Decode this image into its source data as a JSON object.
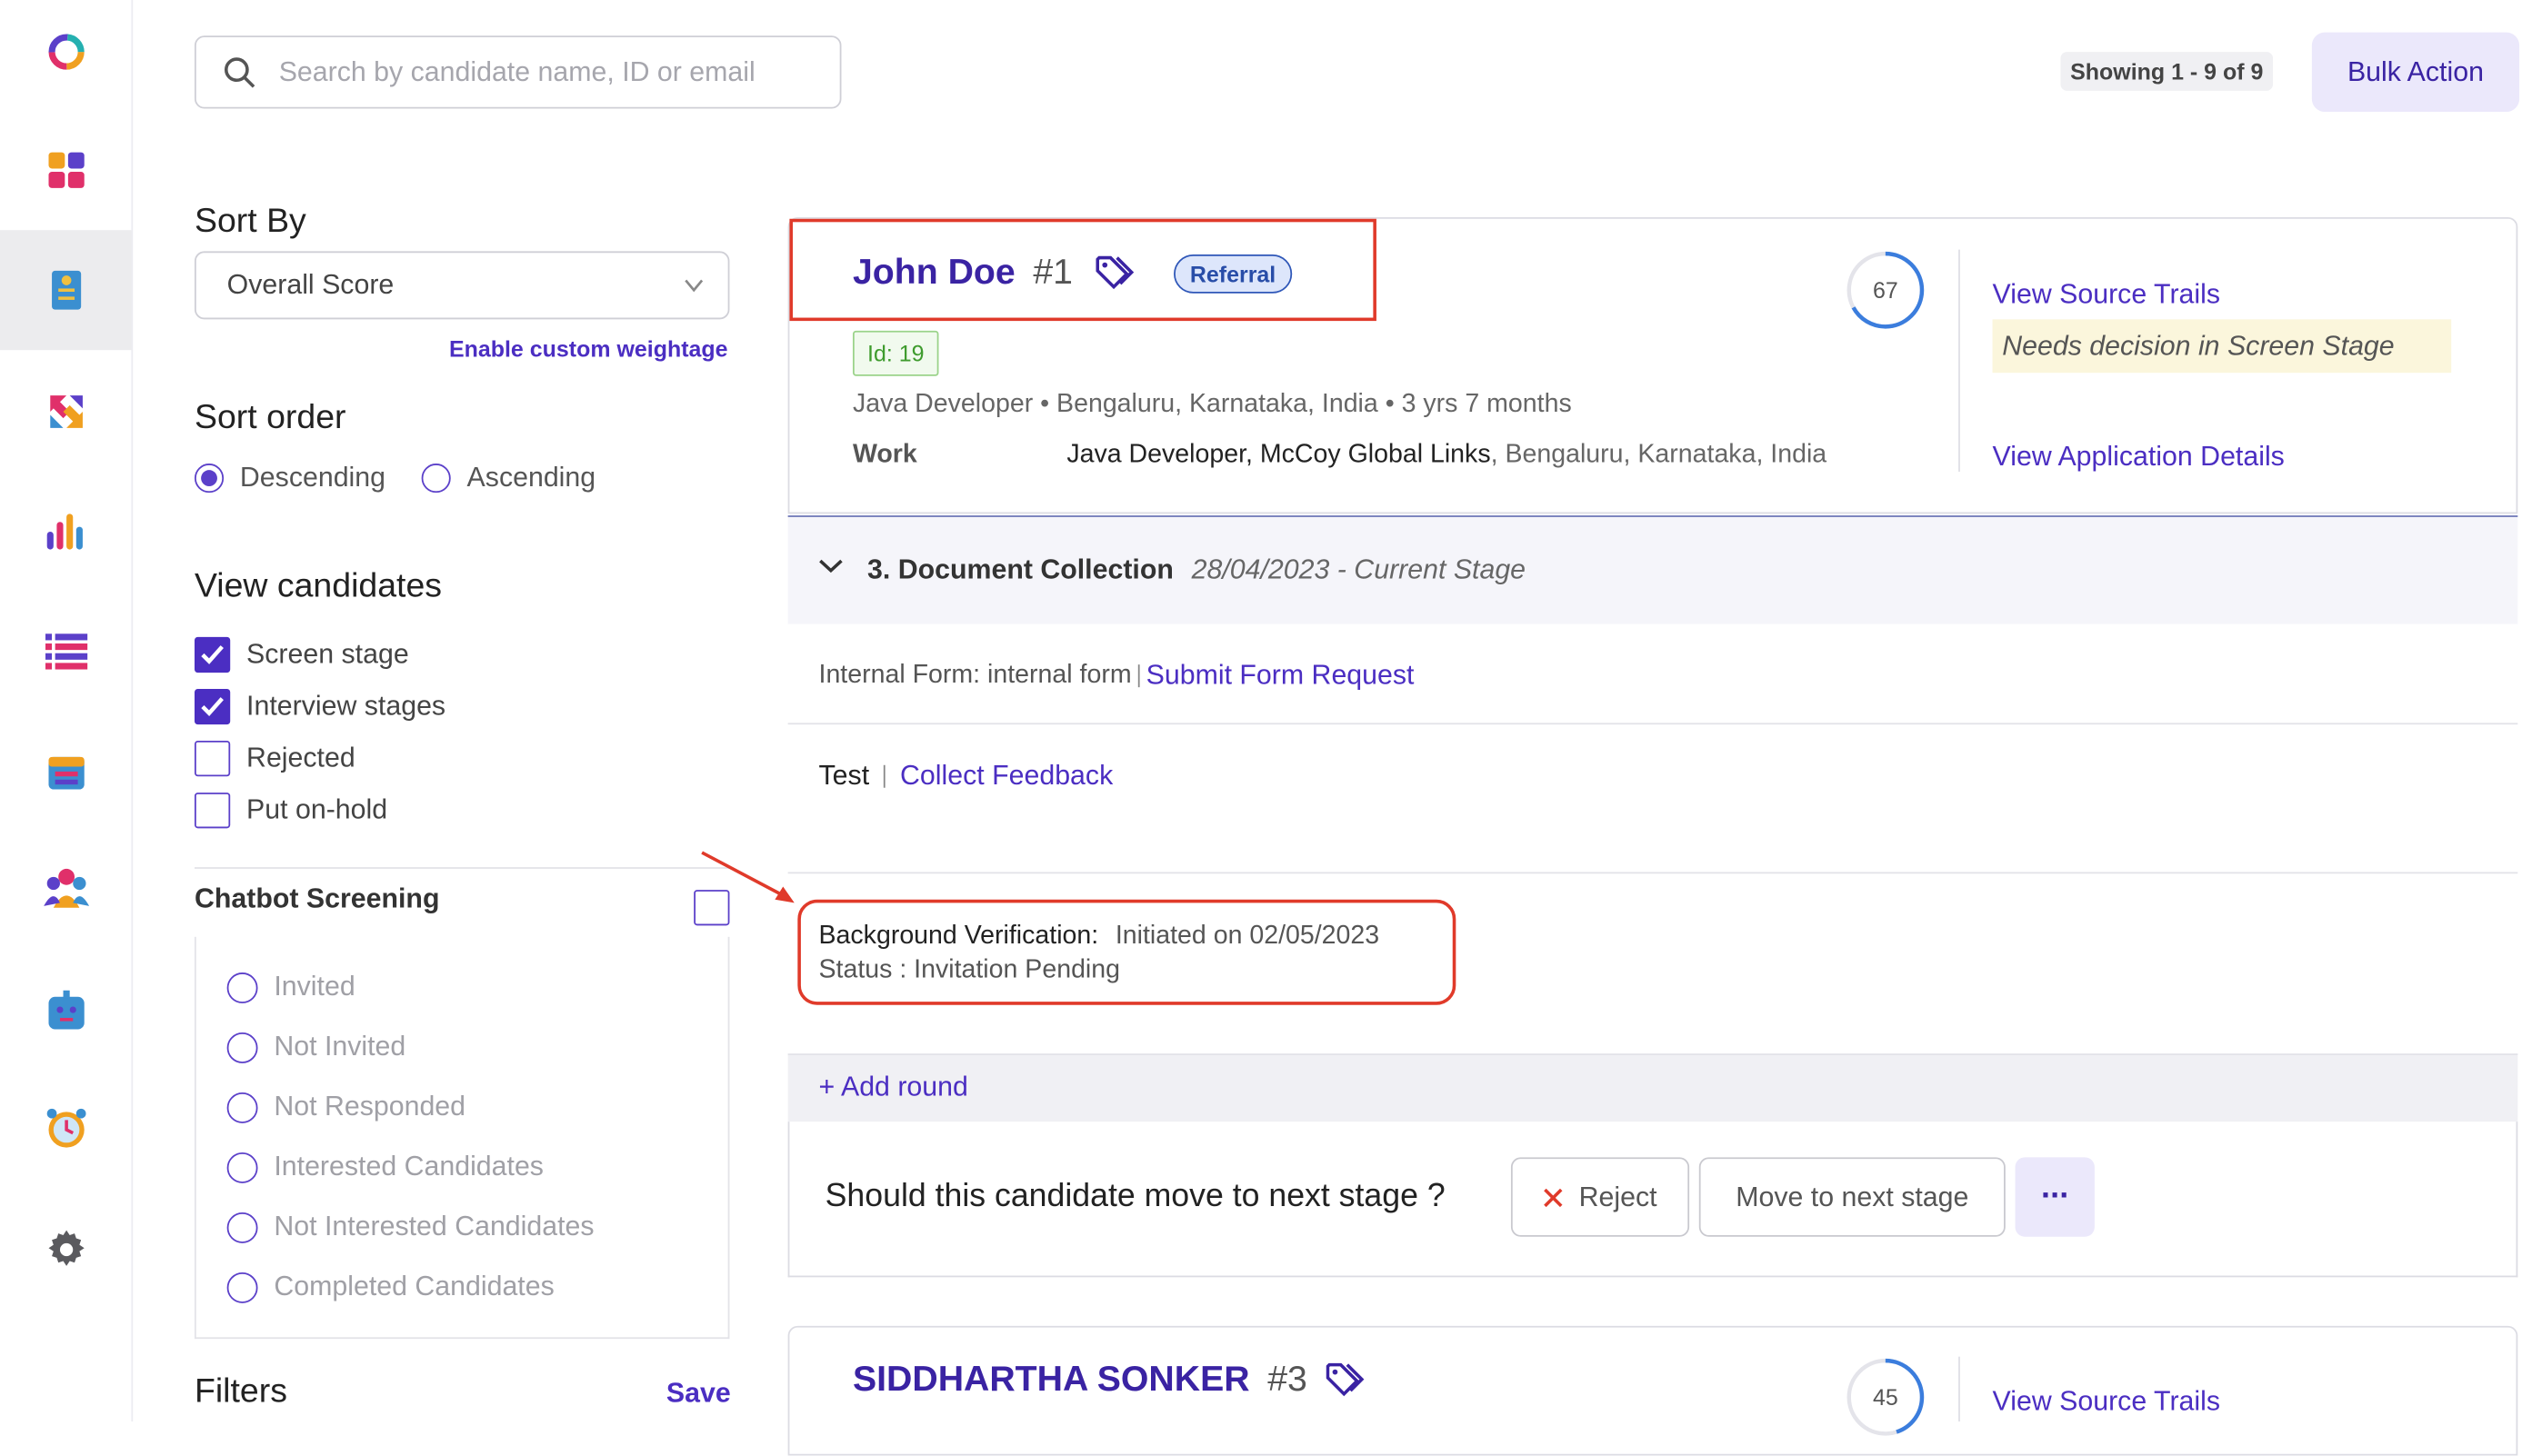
{
  "search": {
    "placeholder": "Search by candidate name, ID or email"
  },
  "header": {
    "showing": "Showing 1 - 9 of 9",
    "bulk_action": "Bulk Action"
  },
  "sidebar_nav": {
    "icons": [
      "logo-icon",
      "dashboard-icon",
      "jobs-icon",
      "transfer-icon",
      "analytics-icon",
      "list-icon",
      "calendar-icon",
      "team-icon",
      "chatbot-icon",
      "alarm-icon",
      "settings-icon"
    ]
  },
  "sort": {
    "title": "Sort By",
    "selected": "Overall Score",
    "custom_weightage": "Enable custom weightage",
    "order_title": "Sort order",
    "descending": "Descending",
    "ascending": "Ascending",
    "order_selected": "Descending"
  },
  "view": {
    "title": "View candidates",
    "options": [
      {
        "label": "Screen stage",
        "checked": true
      },
      {
        "label": "Interview stages",
        "checked": true
      },
      {
        "label": "Rejected",
        "checked": false
      },
      {
        "label": "Put on-hold",
        "checked": false
      }
    ]
  },
  "chatbot": {
    "title": "Chatbot Screening",
    "options": [
      "Invited",
      "Not Invited",
      "Not Responded",
      "Interested Candidates",
      "Not Interested Candidates",
      "Completed Candidates"
    ]
  },
  "filters": {
    "title": "Filters",
    "save": "Save"
  },
  "candidate1": {
    "name": "John Doe",
    "number": "#1",
    "badge": "Referral",
    "id": "Id: 19",
    "summary": "Java Developer • Bengaluru, Karnataka, India • 3 yrs 7 months",
    "work_label": "Work",
    "work_role": "Java Developer",
    "work_company": ", McCoy Global Links",
    "work_location": ", Bengaluru, Karnataka, India",
    "score": "67",
    "score_pct": 67,
    "view_source_trails": "View Source Trails",
    "needs_decision": "Needs decision in Screen Stage",
    "view_application": "View Application Details"
  },
  "stage": {
    "name": "3. Document Collection",
    "date": "28/04/2023 - Current Stage",
    "internal_form": "Internal Form: internal form",
    "submit_form": "Submit Form Request",
    "test": "Test",
    "collect_feedback": "Collect Feedback",
    "bgv_label": "Background Verification:",
    "bgv_initiated": "Initiated on 02/05/2023",
    "bgv_status": "Status : Invitation Pending",
    "add_round": "+ Add round"
  },
  "decision": {
    "question": "Should this candidate move to next stage ?",
    "reject": "Reject",
    "next": "Move to next stage",
    "more": "···"
  },
  "candidate2": {
    "name": "SIDDHARTHA SONKER",
    "number": "#3",
    "score": "45",
    "score_pct": 45,
    "view_source_trails": "View Source Trails"
  },
  "colors": {
    "brand": "#4b2ec2",
    "highlight": "#e03a2a",
    "score_ring": "#3b7ddd"
  }
}
